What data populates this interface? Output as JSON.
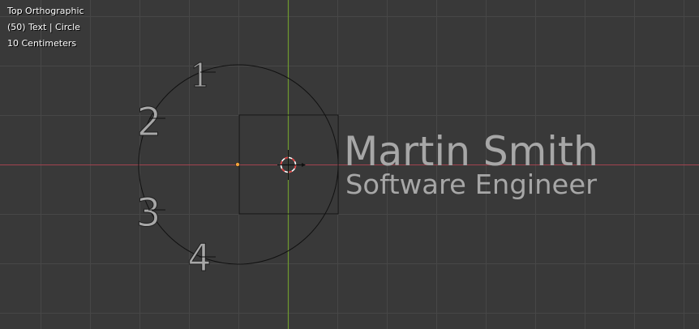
{
  "viewport": {
    "view_name": "Top Orthographic",
    "frame_object": "(50) Text | Circle",
    "grid_scale": "10 Centimeters"
  },
  "scene": {
    "title_text": "Martin Smith",
    "subtitle_text": "Software Engineer",
    "numbers": [
      "1",
      "2",
      "3",
      "4"
    ]
  },
  "colors": {
    "background": "#393939",
    "grid_line": "#474747",
    "x_axis": "#a2434f",
    "y_axis": "#6f9a2f",
    "wireframe": "#111111",
    "text_fill": "#a7a7a7",
    "origin_dot": "#f2a23a",
    "cursor_red": "#e23b3b",
    "overlay_text": "#ffffff"
  }
}
